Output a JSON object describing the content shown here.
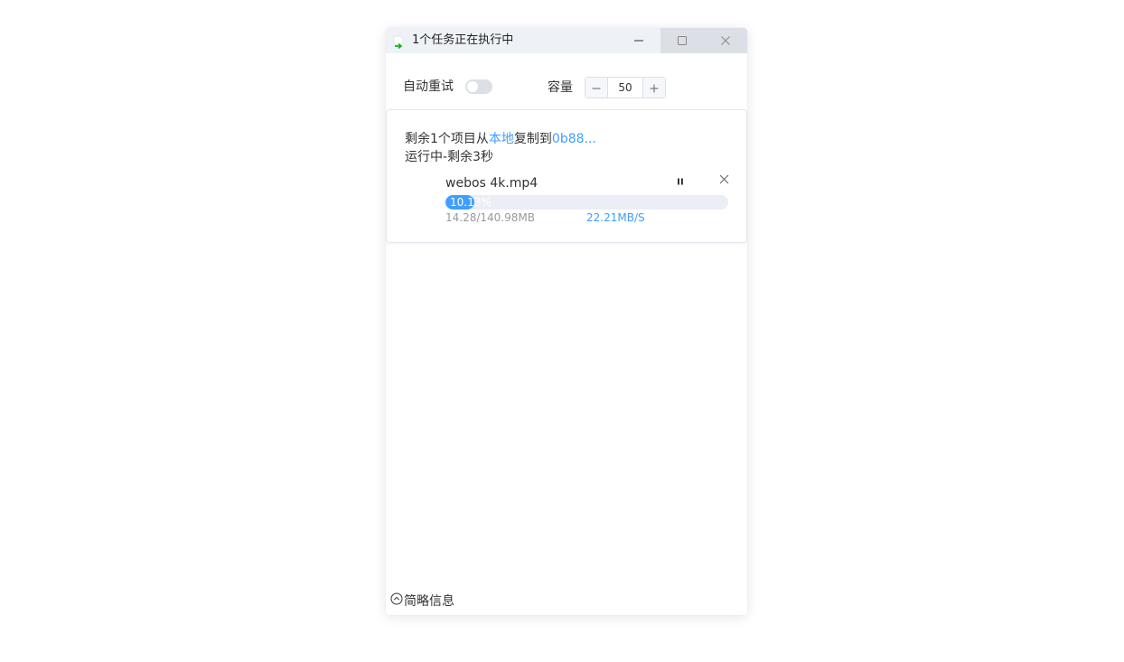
{
  "window": {
    "title": "1个任务正在执行中",
    "icons": {
      "app": "file-copy-icon",
      "minimize": "minimize-icon",
      "maximize": "maximize-icon",
      "close": "close-icon"
    }
  },
  "toolbar": {
    "auto_retry_label": "自动重试",
    "auto_retry_enabled": false,
    "capacity_label": "容量",
    "capacity_value": "50",
    "decrement_symbol": "−",
    "increment_symbol": "+"
  },
  "task": {
    "summary_prefix": "剩余1个项目从",
    "source": "本地",
    "summary_middle": "复制到",
    "destination": "0b88...",
    "status": "运行中-剩余3秒",
    "file": {
      "name": "webos 4k.mp4",
      "progress_percent": 10.13,
      "progress_label": "10.13%",
      "size": "14.28/140.98MB",
      "speed": "22.21MB/S"
    }
  },
  "footer": {
    "toggle_label": "简略信息"
  },
  "colors": {
    "accent": "#409eff",
    "titlebar_bg": "#eef2f7",
    "track": "#ebeef5",
    "icon_green": "#1aad19"
  }
}
